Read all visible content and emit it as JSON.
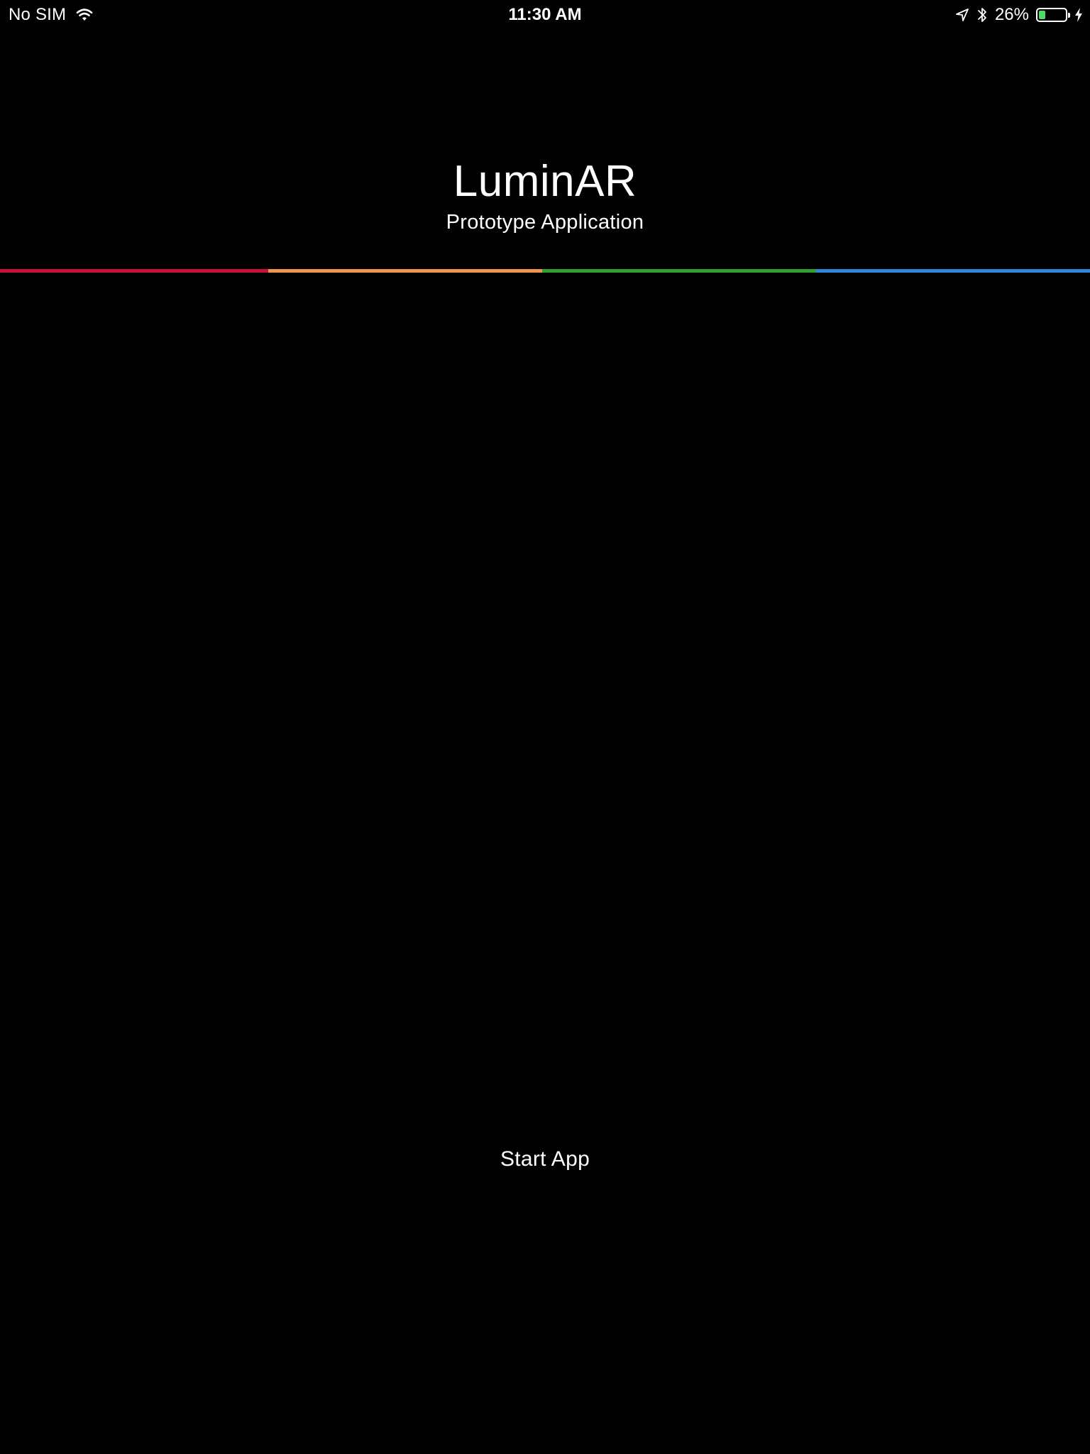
{
  "status_bar": {
    "carrier": "No SIM",
    "time": "11:30 AM",
    "battery_percent_label": "26%",
    "battery_level": 0.26,
    "icons": [
      "wifi-icon",
      "location-arrow-icon",
      "bluetooth-icon",
      "battery-icon",
      "charging-bolt-icon"
    ]
  },
  "header": {
    "title": "LuminAR",
    "subtitle": "Prototype Application"
  },
  "color_bar": {
    "segments": [
      "#c8103a",
      "#f0954a",
      "#2fa12f",
      "#2f86dc"
    ]
  },
  "main": {
    "start_button_label": "Start App"
  },
  "colors": {
    "background": "#000000",
    "text": "#ffffff",
    "battery_fill": "#4cd964"
  }
}
